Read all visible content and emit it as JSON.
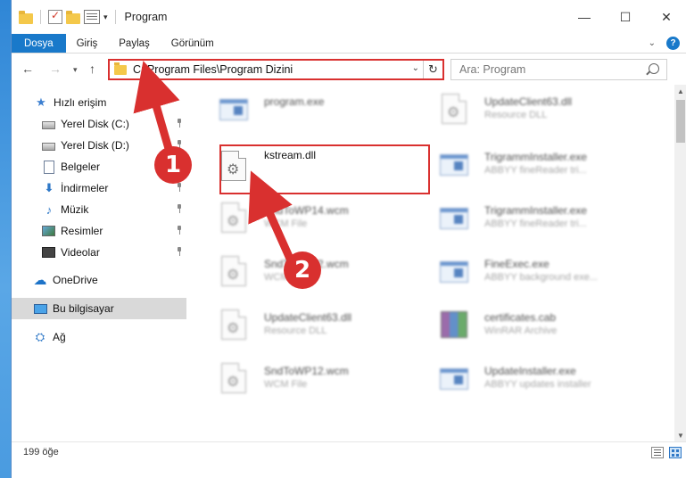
{
  "window": {
    "title": "Program",
    "controls": {
      "minimize": "—",
      "maximize": "☐",
      "close": "✕"
    }
  },
  "ribbon": {
    "tabs": [
      {
        "label": "Dosya",
        "active": true
      },
      {
        "label": "Giriş"
      },
      {
        "label": "Paylaş"
      },
      {
        "label": "Görünüm"
      }
    ],
    "help": "?",
    "collapse": "⌄"
  },
  "navigation": {
    "back": "←",
    "forward": "→",
    "recent": "▾",
    "up": "↑"
  },
  "address": {
    "path": "C:\\Program Files\\Program Dizini",
    "dropdown": "⌄",
    "refresh": "↻"
  },
  "search": {
    "placeholder": "Ara: Program"
  },
  "sidebar": {
    "items": [
      {
        "label": "Hızlı erişim",
        "icon": "star-icon",
        "glyph": "★"
      },
      {
        "label": "Yerel Disk (C:)",
        "icon": "drive-icon",
        "pinned": true
      },
      {
        "label": "Yerel Disk (D:)",
        "icon": "drive-icon",
        "pinned": true
      },
      {
        "label": "Belgeler",
        "icon": "document-icon",
        "pinned": true
      },
      {
        "label": "İndirmeler",
        "icon": "download-icon",
        "glyph": "⬇",
        "pinned": true
      },
      {
        "label": "Müzik",
        "icon": "music-icon",
        "glyph": "♪",
        "pinned": true
      },
      {
        "label": "Resimler",
        "icon": "pictures-icon",
        "pinned": true
      },
      {
        "label": "Videolar",
        "icon": "videos-icon",
        "pinned": true
      },
      {
        "label": "OneDrive",
        "icon": "cloud-icon",
        "glyph": "☁"
      },
      {
        "label": "Bu bilgisayar",
        "icon": "computer-icon",
        "selected": true
      },
      {
        "label": "Ağ",
        "icon": "network-icon",
        "glyph": "⛭"
      }
    ]
  },
  "files": [
    {
      "name": "program.exe",
      "type": "",
      "kind": "exe",
      "blurred": true
    },
    {
      "name": "kstream.dll",
      "type": "",
      "kind": "dll",
      "blurred": false,
      "highlighted": true
    },
    {
      "name": "SndToWP14.wcm",
      "type": "WCM File",
      "kind": "dll",
      "blurred": true
    },
    {
      "name": "SndToWP12.wcm",
      "type": "WCM File",
      "kind": "dll",
      "blurred": true
    },
    {
      "name": "UpdateClient63.dll",
      "type": "Resource DLL",
      "kind": "dll",
      "blurred": true
    },
    {
      "name": "SndToWP12.wcm",
      "type": "WCM File",
      "kind": "dll",
      "blurred": true
    },
    {
      "name": "UpdateClient63.dll",
      "type": "Resource DLL",
      "kind": "dll",
      "blurred": true
    },
    {
      "name": "TrigrammInstaller.exe",
      "type": "ABBYY fineReader tri...",
      "kind": "exe",
      "blurred": true
    },
    {
      "name": "TrigrammInstaller.exe",
      "type": "ABBYY fineReader tri...",
      "kind": "exe",
      "blurred": true
    },
    {
      "name": "FineExec.exe",
      "type": "ABBYY background exe...",
      "kind": "exe",
      "blurred": true
    },
    {
      "name": "certificates.cab",
      "type": "WinRAR Archive",
      "kind": "cab",
      "blurred": true
    },
    {
      "name": "UpdateInstaller.exe",
      "type": "ABBYY updates installer",
      "kind": "exe",
      "blurred": true
    }
  ],
  "status": {
    "count": "199 öğe"
  },
  "annotations": {
    "step1": "1",
    "step2": "2",
    "accent": "#d9302f"
  }
}
